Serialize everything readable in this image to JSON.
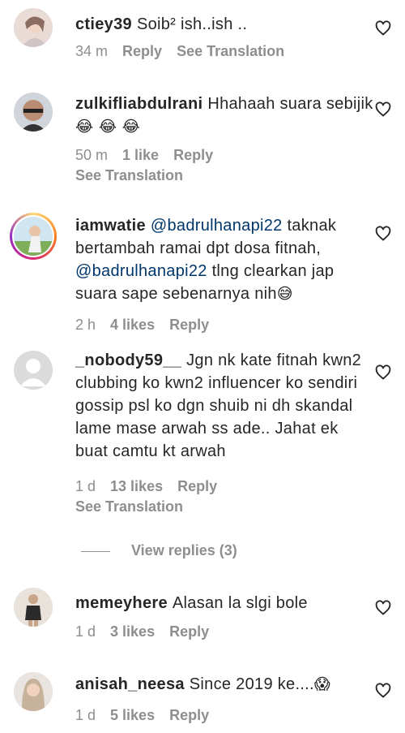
{
  "comments": [
    {
      "username": "ctiey39",
      "text": "Soib² ish..ish ..",
      "time": "34 m",
      "reply_label": "Reply",
      "translation_label": "See Translation"
    },
    {
      "username": "zulkifliabdulrani",
      "text": "Hhahaah suara sebijik",
      "emoji": "😂 😂 😂",
      "time": "50 m",
      "likes": "1 like",
      "reply_label": "Reply",
      "translation_label": "See Translation"
    },
    {
      "username": "iamwatie",
      "mention1": "@badrulhanapi22",
      "text1": "taknak bertambah ramai dpt dosa fitnah,",
      "mention2": "@badrulhanapi22",
      "text2": "tlng clearkan jap suara sape sebenarnya nih",
      "emoji": "😅",
      "time": "2 h",
      "likes": "4 likes",
      "reply_label": "Reply"
    },
    {
      "username": "_nobody59__",
      "text": "Jgn nk kate fitnah kwn2 clubbing ko kwn2 influencer ko sendiri gossip psl ko dgn shuib ni dh skandal lame mase arwah ss ade.. Jahat ek buat camtu kt arwah",
      "time": "1 d",
      "likes": "13 likes",
      "reply_label": "Reply",
      "translation_label": "See Translation",
      "view_replies": "View replies (3)"
    },
    {
      "username": "memeyhere",
      "text": "Alasan la slgi bole",
      "time": "1 d",
      "likes": "3 likes",
      "reply_label": "Reply"
    },
    {
      "username": "anisah_neesa",
      "text": "Since 2019 ke....",
      "emoji": "😱",
      "time": "1 d",
      "likes": "5 likes",
      "reply_label": "Reply"
    }
  ],
  "icons": {
    "heart": "heart-outline-icon",
    "avatar_placeholder": "default-avatar-icon"
  },
  "colors": {
    "text": "#262626",
    "meta": "#8e8e8e",
    "mention": "#00376b"
  }
}
